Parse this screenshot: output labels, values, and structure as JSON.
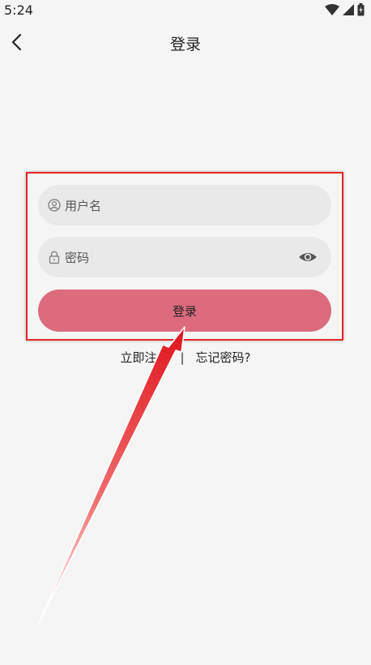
{
  "status_bar": {
    "time": "5:24"
  },
  "nav": {
    "title": "登录"
  },
  "form": {
    "username_placeholder": "用户名",
    "password_placeholder": "密码",
    "login_label": "登录"
  },
  "links": {
    "register": "立即注册",
    "separator": "|",
    "forgot": "忘记密码?"
  },
  "colors": {
    "background": "#f5f5f5",
    "field": "#e9e9e9",
    "login_button": "#dd6b7e",
    "highlight": "#e8262a"
  },
  "icons": [
    "back-arrow-icon",
    "user-icon",
    "lock-icon",
    "eye-icon",
    "wifi-icon",
    "signal-icon",
    "battery-icon"
  ]
}
